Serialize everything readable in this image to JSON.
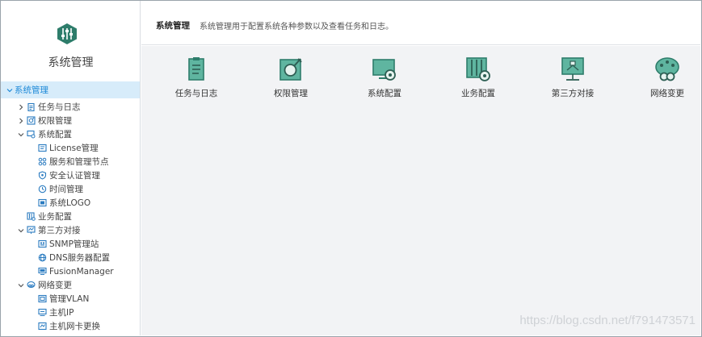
{
  "sidebar": {
    "title": "系统管理",
    "root_label": "系统管理",
    "items": [
      {
        "label": "任务与日志"
      },
      {
        "label": "权限管理"
      },
      {
        "label": "系统配置"
      },
      {
        "label": "License管理"
      },
      {
        "label": "服务和管理节点"
      },
      {
        "label": "安全认证管理"
      },
      {
        "label": "时间管理"
      },
      {
        "label": "系统LOGO"
      },
      {
        "label": "业务配置"
      },
      {
        "label": "第三方对接"
      },
      {
        "label": "SNMP管理站"
      },
      {
        "label": "DNS服务器配置"
      },
      {
        "label": "FusionManager"
      },
      {
        "label": "网络变更"
      },
      {
        "label": "管理VLAN"
      },
      {
        "label": "主机IP"
      },
      {
        "label": "主机网卡更换"
      }
    ]
  },
  "header": {
    "title": "系统管理",
    "description": "系统管理用于配置系统各种参数以及查看任务和日志。"
  },
  "tiles": [
    {
      "label": "任务与日志",
      "icon": "task-log-icon"
    },
    {
      "label": "权限管理",
      "icon": "permission-icon"
    },
    {
      "label": "系统配置",
      "icon": "system-config-icon"
    },
    {
      "label": "业务配置",
      "icon": "service-config-icon"
    },
    {
      "label": "第三方对接",
      "icon": "third-party-icon"
    },
    {
      "label": "网络变更",
      "icon": "network-change-icon"
    }
  ],
  "watermark": "https://blog.csdn.net/f791473571",
  "colors": {
    "accent": "#1f8ad8",
    "selected_bg": "#d7ecfa",
    "icon_green": "#2e7d6b",
    "icon_green_fill": "#5fb5a0",
    "content_bg": "#f2f3f5"
  }
}
